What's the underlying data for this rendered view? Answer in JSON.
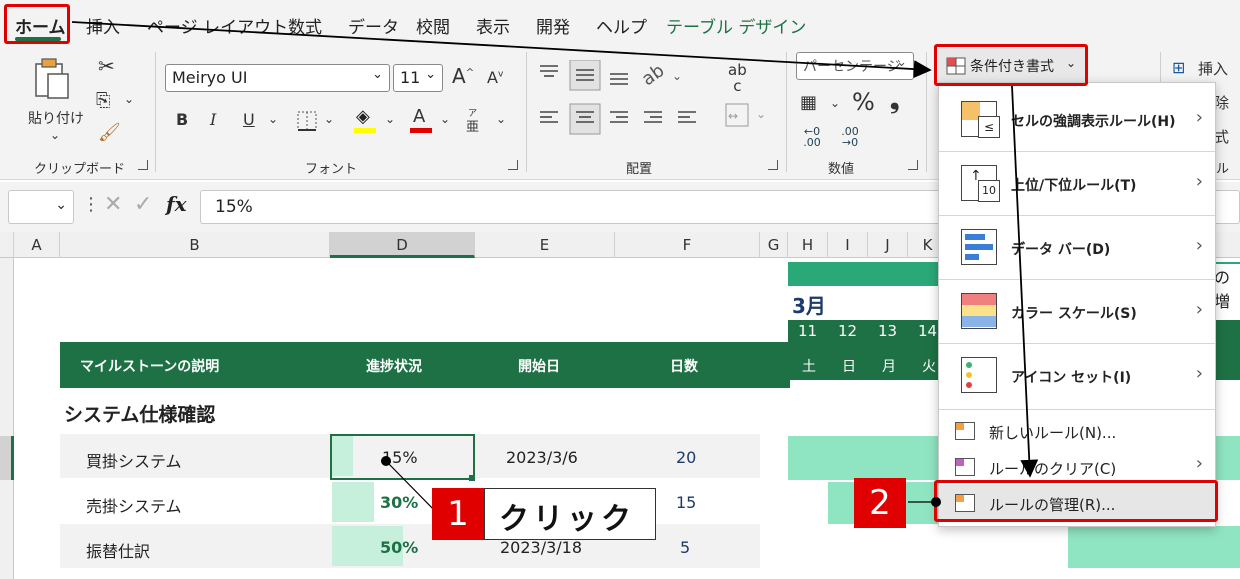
{
  "ribbon_tabs": [
    {
      "label": "ホーム",
      "active": true
    },
    {
      "label": "挿入"
    },
    {
      "label": "ページ レイアウト"
    },
    {
      "label": "数式"
    },
    {
      "label": "データ"
    },
    {
      "label": "校閲"
    },
    {
      "label": "表示"
    },
    {
      "label": "開発"
    },
    {
      "label": "ヘルプ"
    },
    {
      "label": "テーブル デザイン",
      "contextual": true
    }
  ],
  "clipboard": {
    "paste_label": "貼り付け",
    "group_label": "クリップボード"
  },
  "font": {
    "family": "Meiryo UI",
    "size": "11",
    "group_label": "フォント",
    "bold": "B",
    "italic": "I",
    "underline": "U",
    "grow": "A",
    "shrink": "A",
    "font_color": "A",
    "phonetic": "亜"
  },
  "alignment": {
    "group_label": "配置",
    "wrap_glyph": "ab",
    "wrap_glyph2": "c"
  },
  "number": {
    "format": "パーセンテージ",
    "group_label": "数値",
    "percent": "%",
    "comma": "❟",
    "inc_decimal": "←0 .00",
    "dec_decimal": ".00 →0"
  },
  "styles": {
    "conditional_formatting_label": "条件付き書式"
  },
  "cells_group": {
    "insert_label": "挿入",
    "delete_partial": "除",
    "format_partial": "式",
    "group_partial": "ル"
  },
  "formula_bar": {
    "fx": "fx",
    "value": "15%"
  },
  "columns": [
    "A",
    "B",
    "D",
    "E",
    "F",
    "G",
    "H",
    "I",
    "J",
    "K"
  ],
  "table": {
    "headers": [
      "マイルストーンの説明",
      "進捗状況",
      "開始日",
      "日数"
    ],
    "section_title": "システム仕様確認",
    "rows": [
      {
        "name": "買掛システム",
        "progress": "15%",
        "progress_value": 0.15,
        "start": "2023/3/6",
        "days": "20"
      },
      {
        "name": "売掛システム",
        "progress": "30%",
        "progress_value": 0.3,
        "start": "",
        "days": "15"
      },
      {
        "name": "振替仕訳",
        "progress": "50%",
        "progress_value": 0.5,
        "start": "2023/3/18",
        "days": "5"
      }
    ]
  },
  "gantt": {
    "month": "3月",
    "days": [
      "11",
      "12",
      "13",
      "14"
    ],
    "weekdays": [
      "土",
      "日",
      "月",
      "火"
    ],
    "partial_text": "の増"
  },
  "menu": {
    "items": [
      {
        "label": "セルの強調表示ルール(H)",
        "submenu": true
      },
      {
        "label": "上位/下位ルール(T)",
        "submenu": true
      },
      {
        "label": "データ バー(D)",
        "submenu": true
      },
      {
        "label": "カラー スケール(S)",
        "submenu": true
      },
      {
        "label": "アイコン セット(I)",
        "submenu": true
      }
    ],
    "small_items": [
      {
        "label": "新しいルール(N)...",
        "submenu": false
      },
      {
        "label": "ルールのクリア(C)",
        "submenu": true
      },
      {
        "label": "ルールの管理(R)...",
        "submenu": false
      }
    ],
    "icon_number": "10",
    "icon_le": "≤"
  },
  "annotations": {
    "step1_number": "1",
    "step1_text": "クリック",
    "step2_number": "2"
  },
  "colors": {
    "accent_green": "#1e7145",
    "highlight_red": "#e00000",
    "progress_fill": "#c6efdc",
    "gantt_fill": "#8fe5c2"
  }
}
